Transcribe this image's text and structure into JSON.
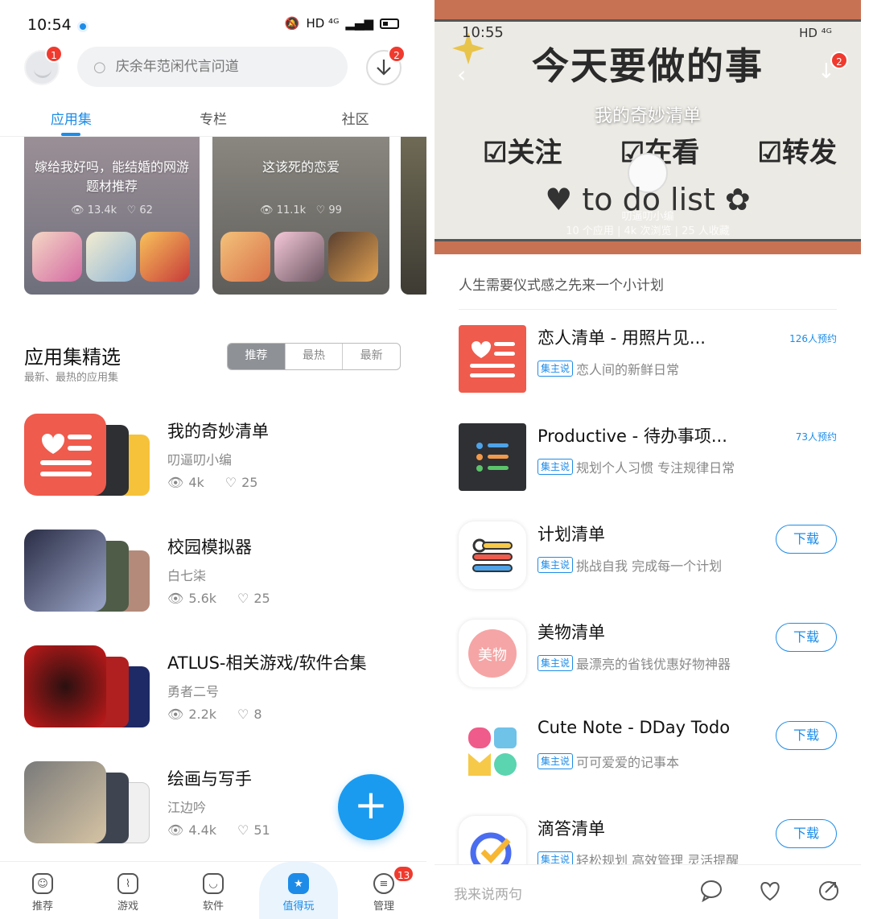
{
  "left": {
    "status": {
      "time": "10:54",
      "signal": "HD ⁴ᴳ",
      "badge_avatar": "1"
    },
    "search": {
      "placeholder": "庆余年范闲代言问道"
    },
    "download_badge": "2",
    "tabs": [
      {
        "label": "应用集"
      },
      {
        "label": "专栏"
      },
      {
        "label": "社区"
      }
    ],
    "cards": [
      {
        "title": "嫁给我好吗，能结婚的网游题材推荐",
        "views": "13.4k",
        "likes": "62"
      },
      {
        "title": "这该死的恋爱",
        "views": "11.1k",
        "likes": "99"
      }
    ],
    "section": {
      "title": "应用集精选",
      "subtitle": "最新、最热的应用集",
      "seg": [
        "推荐",
        "最热",
        "最新"
      ]
    },
    "collections": [
      {
        "name": "我的奇妙清单",
        "author": "叨逼叨小编",
        "views": "4k",
        "likes": "25"
      },
      {
        "name": "校园模拟器",
        "author": "白七柒",
        "views": "5.6k",
        "likes": "25"
      },
      {
        "name": "ATLUS-相关游戏/软件合集",
        "author": "勇者二号",
        "views": "2.2k",
        "likes": "8"
      },
      {
        "name": "绘画与写手",
        "author": "江边吟",
        "views": "4.4k",
        "likes": "51"
      }
    ],
    "fab": "+",
    "nav": [
      {
        "label": "推荐"
      },
      {
        "label": "游戏"
      },
      {
        "label": "软件"
      },
      {
        "label": "值得玩"
      },
      {
        "label": "管理",
        "badge": "13"
      }
    ]
  },
  "right": {
    "status": {
      "time": "10:55",
      "signal": "HD ⁴ᴳ"
    },
    "download_badge": "2",
    "hero": {
      "banner": "今天要做的事",
      "title": "我的奇妙清单",
      "checks": [
        "☑关注",
        "☑在看",
        "☑转发"
      ],
      "todo": "♥ to do list ✿",
      "author": "叨逼叨小编",
      "meta": "10 个应用 | 4k 次浏览 | 25 人收藏"
    },
    "description": "人生需要仪式感之先来一个小计划",
    "tag_label": "集主说",
    "apps": [
      {
        "name": "恋人清单 - 用照片见...",
        "tag": "恋人间的新鲜日常",
        "action": "126人预约"
      },
      {
        "name": "Productive - 待办事项...",
        "tag": "规划个人习惯 专注规律日常",
        "action": "73人预约"
      },
      {
        "name": "计划清单",
        "tag": "挑战自我 完成每一个计划",
        "action": "下载"
      },
      {
        "name": "美物清单",
        "tag": "最漂亮的省钱优惠好物神器",
        "action": "下载"
      },
      {
        "name": "Cute Note - DDay Todo",
        "tag": "可可爱爱的记事本",
        "action": "下载"
      },
      {
        "name": "滴答清单",
        "tag": "轻松规划 高效管理 灵活提醒",
        "action": "下载"
      }
    ],
    "comment": {
      "placeholder": "我来说两句"
    }
  },
  "colors": {
    "accent": "#1c8ce8",
    "badge": "#f03a2e",
    "list_icon_red": "#ef5b4c"
  }
}
